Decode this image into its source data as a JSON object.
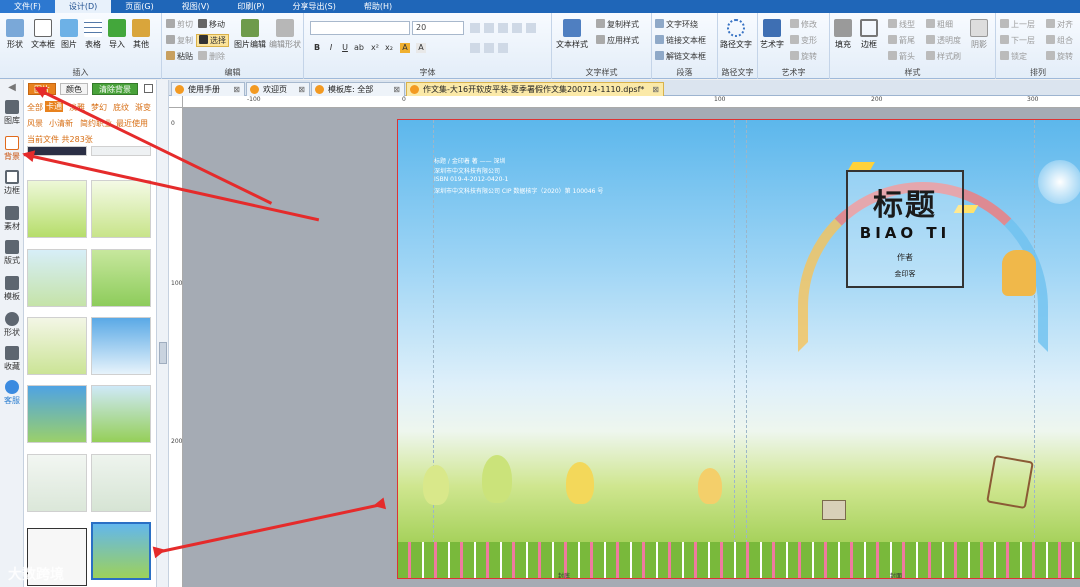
{
  "menubar": {
    "items": [
      {
        "label": "文件(F)"
      },
      {
        "label": "设计(D)"
      },
      {
        "label": "页面(G)"
      },
      {
        "label": "视图(V)"
      },
      {
        "label": "印刷(P)"
      },
      {
        "label": "分享导出(S)"
      },
      {
        "label": "帮助(H)"
      }
    ]
  },
  "ribbon": {
    "insert": {
      "label": "插入",
      "buttons": [
        "形状",
        "文本框",
        "图片",
        "表格",
        "导入",
        "其他"
      ]
    },
    "edit": {
      "label": "编辑",
      "cut": "剪切",
      "copy": "复制",
      "paste": "粘贴",
      "move": "移动",
      "select": "选择",
      "delete": "删除",
      "image_edit": "图片编辑",
      "shape_edit": "编辑形状"
    },
    "font": {
      "label": "字体",
      "font_name": "",
      "font_size": "20"
    },
    "text_style": {
      "label": "文字样式",
      "btn": "文本样式",
      "copy_style": "复制样式",
      "apply_style": "应用样式"
    },
    "paragraph": {
      "label": "段落",
      "wrap": "文字环绕",
      "link_box": "链接文本框",
      "unlink_box": "解链文本框"
    },
    "path_text": {
      "label": "路径文字",
      "btn": "路径文字"
    },
    "art_text": {
      "label": "艺术字",
      "btn": "艺术字",
      "modify": "修改",
      "transform": "变形",
      "rotate": "旋转"
    },
    "style": {
      "label": "样式",
      "fill": "填充",
      "border": "边框",
      "line_shape": "线型",
      "arrow_head": "箭尾",
      "arrow_tail": "箭头",
      "thickness": "粗细",
      "transparency": "透明度",
      "style_copy": "样式刷",
      "shadow": "阴影"
    },
    "arrange": {
      "label": "排列",
      "up": "上一层",
      "down": "下一层",
      "lock": "锁定",
      "align": "对齐",
      "combine": "组合",
      "rotate": "旋转"
    }
  },
  "rail": {
    "items": [
      "图库",
      "背景",
      "边框",
      "素材",
      "版式",
      "模板",
      "形状",
      "收藏",
      "客服"
    ],
    "active": "背景"
  },
  "panel": {
    "tabs": {
      "image": "图片",
      "color": "颜色",
      "clear": "清除背景"
    },
    "categories": [
      "全部",
      "卡通",
      "淡雅",
      "梦幻",
      "底纹",
      "渐变",
      "风景",
      "小清新",
      "简约职业",
      "最近使用"
    ],
    "active_category": "卡通",
    "count_text": "当前文件 共283张"
  },
  "doc_tabs": [
    {
      "label": "使用手册"
    },
    {
      "label": "欢迎页"
    },
    {
      "label": "模板库: 全部"
    },
    {
      "label": "作文集-大16开软皮平装-夏季署假作文集200714-1110.dpsf*"
    }
  ],
  "ruler": {
    "h": [
      "-100",
      "0",
      "100",
      "200",
      "300"
    ],
    "v": [
      "0",
      "100",
      "200"
    ]
  },
  "cover": {
    "info_lines": [
      "标题 / 金印着 著 —— 深圳",
      "深圳市中文科技有限公司",
      "ISBN  019-4-2012-0420-1",
      "深圳市中文科技有限公司 CIP 数据核字（2020）第 100046 号"
    ],
    "title_cn": "标题",
    "title_en": "BIAO TI",
    "author_label": "作者",
    "author_name": "金印客",
    "back_label": "封底",
    "front_label": "封面"
  },
  "watermark": "大数跨境",
  "colors": {
    "accent": "#e8821e",
    "menubar": "#1f66b8",
    "arrow": "#e52b2b"
  }
}
